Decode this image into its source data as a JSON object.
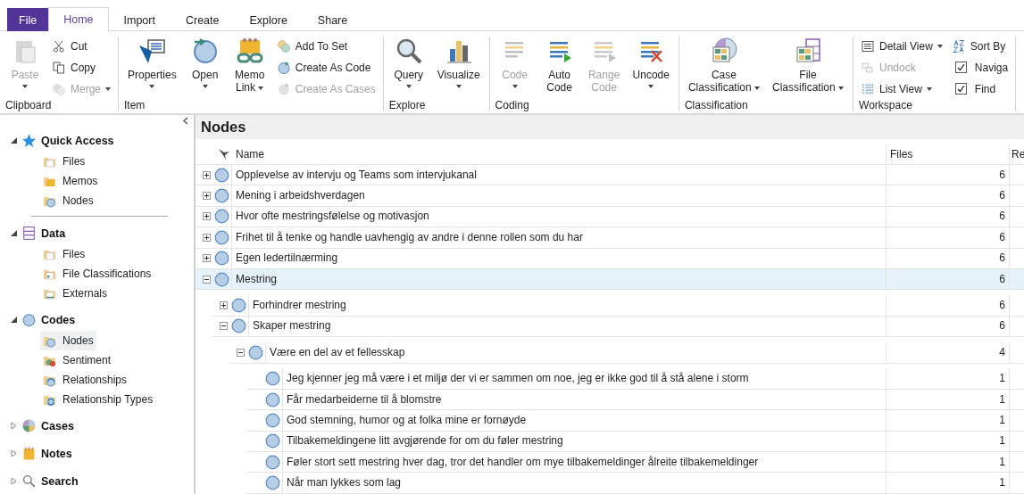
{
  "ribbon": {
    "file_tab": {
      "label": "File"
    },
    "tabs": [
      {
        "label": "Home",
        "selected": true
      },
      {
        "label": "Import",
        "selected": false
      },
      {
        "label": "Create",
        "selected": false
      },
      {
        "label": "Explore",
        "selected": false
      },
      {
        "label": "Share",
        "selected": false
      }
    ],
    "groups": [
      {
        "label": "Clipboard",
        "columns": [
          [
            {
              "kind": "large",
              "label": "Paste",
              "disabled": true,
              "dropdown": true
            }
          ],
          [
            {
              "kind": "small",
              "label": "Cut",
              "disabled": false,
              "dropdown": false
            },
            {
              "kind": "small",
              "label": "Copy",
              "disabled": false,
              "dropdown": false
            },
            {
              "kind": "small",
              "label": "Merge",
              "disabled": true,
              "dropdown": true
            }
          ]
        ]
      },
      {
        "label": "Item",
        "columns": [
          [
            {
              "kind": "large",
              "label": "Properties",
              "disabled": false,
              "dropdown": true
            }
          ],
          [
            {
              "kind": "large",
              "label": "Open",
              "disabled": false,
              "dropdown": true
            }
          ],
          [
            {
              "kind": "large",
              "label": "Memo Link",
              "disabled": false,
              "dropdown": true
            }
          ],
          [
            {
              "kind": "small",
              "label": "Add To Set",
              "disabled": false,
              "dropdown": false
            },
            {
              "kind": "small",
              "label": "Create As Code",
              "disabled": false,
              "dropdown": false
            },
            {
              "kind": "small",
              "label": "Create As Cases",
              "disabled": true,
              "dropdown": false
            }
          ]
        ]
      },
      {
        "label": "Explore",
        "columns": [
          [
            {
              "kind": "large",
              "label": "Query",
              "disabled": false,
              "dropdown": true
            }
          ],
          [
            {
              "kind": "large",
              "label": "Visualize",
              "disabled": false,
              "dropdown": true
            }
          ]
        ]
      },
      {
        "label": "Coding",
        "columns": [
          [
            {
              "kind": "large",
              "label": "Code",
              "disabled": true,
              "dropdown": true
            }
          ],
          [
            {
              "kind": "large",
              "label": "Auto Code",
              "disabled": false,
              "dropdown": false
            }
          ],
          [
            {
              "kind": "large",
              "label": "Range Code",
              "disabled": true,
              "dropdown": false
            }
          ],
          [
            {
              "kind": "large",
              "label": "Uncode",
              "disabled": false,
              "dropdown": true
            }
          ]
        ]
      },
      {
        "label": "Classification",
        "columns": [
          [
            {
              "kind": "large",
              "label": "Case Classification",
              "disabled": false,
              "dropdown": true
            }
          ],
          [
            {
              "kind": "large",
              "label": "File Classification",
              "disabled": false,
              "dropdown": true
            }
          ]
        ]
      },
      {
        "label": "Workspace",
        "columns": [
          [
            {
              "kind": "small",
              "label": "Detail View",
              "disabled": false,
              "dropdown": true
            },
            {
              "kind": "small",
              "label": "Undock",
              "disabled": true,
              "dropdown": false
            },
            {
              "kind": "small",
              "label": "List View",
              "disabled": false,
              "dropdown": true
            }
          ],
          [
            {
              "kind": "small",
              "label": "Sort By",
              "disabled": false,
              "dropdown": false
            },
            {
              "kind": "check",
              "label": "Naviga",
              "checked": true
            },
            {
              "kind": "check",
              "label": "Find",
              "checked": true
            }
          ]
        ]
      }
    ]
  },
  "navigation": {
    "sections": [
      {
        "label": "Quick Access",
        "expanded": true,
        "divider": true,
        "items": [
          {
            "label": "Files",
            "selected": false
          },
          {
            "label": "Memos",
            "selected": false
          },
          {
            "label": "Nodes",
            "selected": false
          }
        ]
      },
      {
        "label": "Data",
        "expanded": true,
        "items": [
          {
            "label": "Files",
            "selected": false
          },
          {
            "label": "File Classifications",
            "selected": false
          },
          {
            "label": "Externals",
            "selected": false
          }
        ]
      },
      {
        "label": "Codes",
        "expanded": true,
        "items": [
          {
            "label": "Nodes",
            "selected": true
          },
          {
            "label": "Sentiment",
            "selected": false
          },
          {
            "label": "Relationships",
            "selected": false
          },
          {
            "label": "Relationship Types",
            "selected": false
          }
        ]
      },
      {
        "label": "Cases",
        "expanded": false
      },
      {
        "label": "Notes",
        "expanded": false
      },
      {
        "label": "Search",
        "expanded": false
      }
    ]
  },
  "nodes": {
    "title": "Nodes",
    "columns": [
      {
        "label": "Name"
      },
      {
        "label": "Files"
      },
      {
        "label": "Re"
      }
    ],
    "rows": [
      {
        "name": "Opplevelse av intervju og Teams som intervjukanal",
        "files": "6",
        "expanded": false,
        "selected": false
      },
      {
        "name": "Mening i arbeidshverdagen",
        "files": "6",
        "expanded": false,
        "selected": false
      },
      {
        "name": "Hvor ofte mestringsfølelse og motivasjon",
        "files": "6",
        "expanded": false,
        "selected": false
      },
      {
        "name": "Frihet til å tenke og handle uavhengig av andre i denne rollen som du har",
        "files": "6",
        "expanded": false,
        "selected": false
      },
      {
        "name": "Egen ledertilnærming",
        "files": "6",
        "expanded": false,
        "selected": false
      },
      {
        "name": "Mestring",
        "files": "6",
        "expanded": true,
        "selected": true,
        "children": [
          {
            "name": "Forhindrer mestring",
            "files": "6",
            "expanded": false,
            "selected": false
          },
          {
            "name": "Skaper mestring",
            "files": "6",
            "expanded": true,
            "selected": false,
            "children": [
              {
                "name": "Være en del av et fellesskap",
                "files": "4",
                "expanded": true,
                "selected": false,
                "children": [
                  {
                    "name": "Jeg kjenner jeg må være i et miljø der vi er sammen om noe, jeg er ikke god til å stå alene i storm",
                    "files": "1",
                    "selected": false
                  },
                  {
                    "name": "Får medarbeiderne til å blomstre",
                    "files": "1",
                    "selected": false
                  },
                  {
                    "name": "God stemning, humor og at folka mine er fornøyde",
                    "files": "1",
                    "selected": false
                  },
                  {
                    "name": "Tilbakemeldingene litt avgjørende for om du føler mestring",
                    "files": "1",
                    "selected": false
                  },
                  {
                    "name": "Føler stort sett mestring hver dag, tror det handler om mye tilbakemeldinger ålreite tilbakemeldinger",
                    "files": "1",
                    "selected": false
                  },
                  {
                    "name": "Når man lykkes som lag",
                    "files": "1",
                    "selected": false
                  }
                ]
              }
            ]
          }
        ]
      }
    ]
  }
}
